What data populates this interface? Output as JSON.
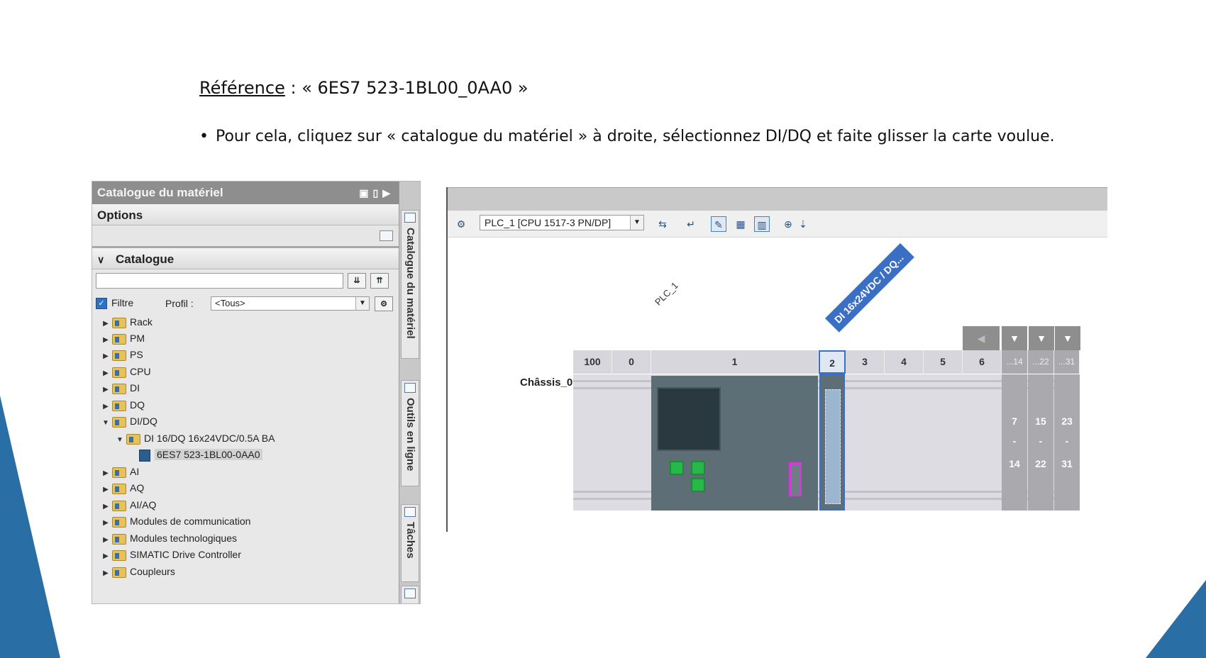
{
  "slide": {
    "ref_label": "Référence",
    "ref_value": " : « 6ES7 523-1BL00_0AA0 »",
    "bullet": "Pour cela, cliquez sur « catalogue du matériel » à droite, sélectionnez DI/DQ et faite glisser la carte voulue."
  },
  "catalog": {
    "title": "Catalogue du matériel",
    "options_label": "Options",
    "catalogue_label": "Catalogue",
    "search_value": "",
    "filter_label": "Filtre",
    "profil_label": "Profil :",
    "profil_value": "<Tous>",
    "tree": [
      "Rack",
      "PM",
      "PS",
      "CPU",
      "DI",
      "DQ",
      "DI/DQ",
      "DI 16/DQ 16x24VDC/0.5A BA",
      "6ES7 523-1BL00-0AA0",
      "AI",
      "AQ",
      "AI/AQ",
      "Modules de communication",
      "Modules technologiques",
      "SIMATIC Drive Controller",
      "Coupleurs"
    ]
  },
  "side_tabs": {
    "tab1": "Catalogue du matériel",
    "tab2": "Outils en ligne",
    "tab3": "Tâches"
  },
  "device_view": {
    "plc_select": "PLC_1 [CPU 1517-3 PN/DP]",
    "plc_name": "PLC_1",
    "module_name": "DI 16x24VDC / DQ...",
    "chassis_label": "Châssis_0",
    "slots": [
      "100",
      "0",
      "1",
      "2",
      "3",
      "4",
      "5",
      "6",
      "...14",
      "...22",
      "...31"
    ],
    "expand_cols": [
      {
        "top": "7",
        "mid": "-",
        "bottom": "14"
      },
      {
        "top": "15",
        "mid": "-",
        "bottom": "22"
      },
      {
        "top": "23",
        "mid": "-",
        "bottom": "31"
      }
    ]
  },
  "icons": {
    "left_arrow": "◀",
    "down_arrow": "▼"
  }
}
